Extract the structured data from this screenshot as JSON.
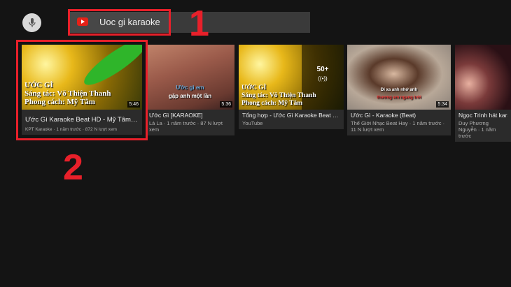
{
  "search": {
    "query": "Uoc  gi karaoke",
    "icon": "youtube-icon",
    "mic_icon": "microphone-icon"
  },
  "annotations": {
    "step1": "1",
    "step2": "2",
    "color": "#e8202a"
  },
  "videos": [
    {
      "title": "Ước Gì Karaoke Beat HD - Mỹ Tâm - KPT...",
      "meta": "KPT Karaoke · 1 năm trước · 872 N lượt xem",
      "duration": "5:46",
      "overlay": [
        "ƯỚC GÌ",
        "Sáng tác: Võ Thiện Thanh",
        "Phong cách: Mỹ Tâm"
      ]
    },
    {
      "title": "[KARAOKE] Ước Gì",
      "meta": "Lá La · 1 năm trước · 87 N lượt xem",
      "duration": "5:36",
      "overlay": [
        "Ước gì em",
        "gặp anh một lần"
      ]
    },
    {
      "title": "Tổng hợp - Ước Gì Karaoke Beat HD - Mỹ...",
      "meta": "YouTube",
      "playlist_count": "50+",
      "overlay": [
        "ƯỚC GÌ",
        "Sáng tác: Võ Thiện Thanh",
        "Phong cách: Mỹ Tâm"
      ]
    },
    {
      "title": "Ước Gì - Karaoke (Beat)",
      "meta": "Thế Giới Nhạc Beat Hay · 1 năm trước · 11 N lượt xem",
      "duration": "5:34",
      "overlay": [
        "Đi xa anh nhớ anh",
        "thương em ngang trời"
      ]
    },
    {
      "title": "Ngọc Trinh hát karaoke",
      "meta": "Duy Phương Nguyễn · 1 năm trước"
    }
  ]
}
